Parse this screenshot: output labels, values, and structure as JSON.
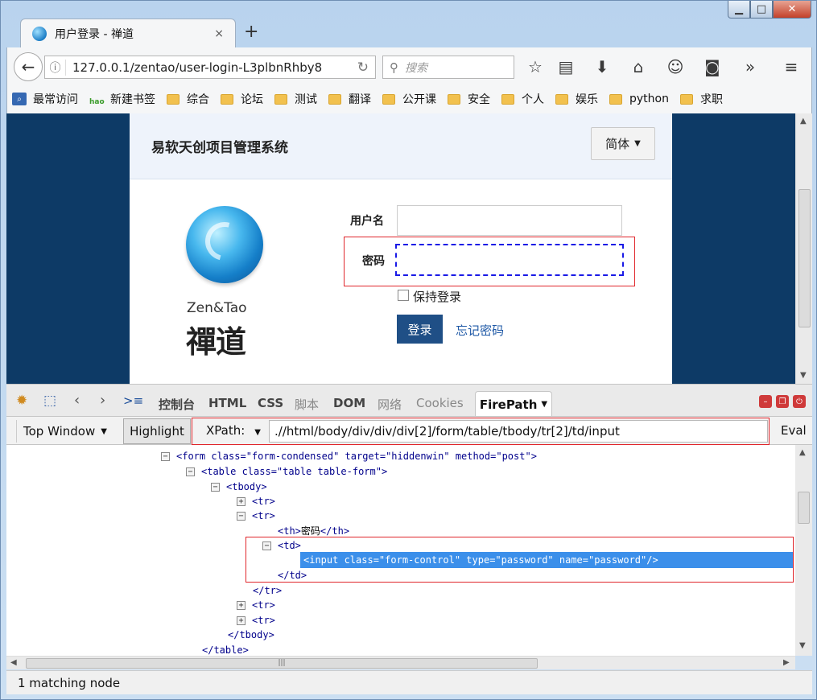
{
  "browser": {
    "tab_title": "用户登录 - 禅道",
    "tab_close": "×",
    "new_tab": "+",
    "url": "127.0.0.1/zentao/user-login-L3plbnRhby8",
    "search_placeholder": "搜索"
  },
  "bookmarks": [
    "最常访问",
    "新建书签",
    "综合",
    "论坛",
    "测试",
    "翻译",
    "公开课",
    "安全",
    "个人",
    "娱乐",
    "python",
    "求职"
  ],
  "page": {
    "app_title": "易软天创项目管理系统",
    "language": "简体",
    "brand_en": "Zen&Tao",
    "brand_cn": "禪道",
    "username_label": "用户名",
    "password_label": "密码",
    "keep_login": "保持登录",
    "login_button": "登录",
    "forgot_password": "忘记密码"
  },
  "firebug": {
    "tabs": [
      "控制台",
      "HTML",
      "CSS",
      "脚本",
      "DOM",
      "网络",
      "Cookies"
    ],
    "active_tab": "FirePath",
    "top_window": "Top Window",
    "highlight": "Highlight",
    "xpath_label": "XPath:",
    "xpath_value": ".//html/body/div/div/div[2]/form/table/tbody/tr[2]/td/input",
    "eval": "Eval",
    "status": "1 matching node"
  },
  "tree": {
    "form_open": "<form  class=\"form-condensed\"  target=\"hiddenwin\"  method=\"post\">",
    "table_open": "<table  class=\"table table-form\">",
    "tbody_open": "<tbody>",
    "tr": "<tr>",
    "th_text": "密码",
    "td_open": "<td>",
    "input_line": "<input  class=\"form-control\"  type=\"password\"  name=\"password\"/>",
    "td_close": "</td>",
    "tr_close": "</tr>",
    "tbody_close": "</tbody>",
    "table_close": "</table>"
  },
  "colors": {
    "page_background": "#0d3a66",
    "login_button": "#1f4f86",
    "highlight_box": "#e0262b",
    "selected_row": "#3b8fea"
  }
}
